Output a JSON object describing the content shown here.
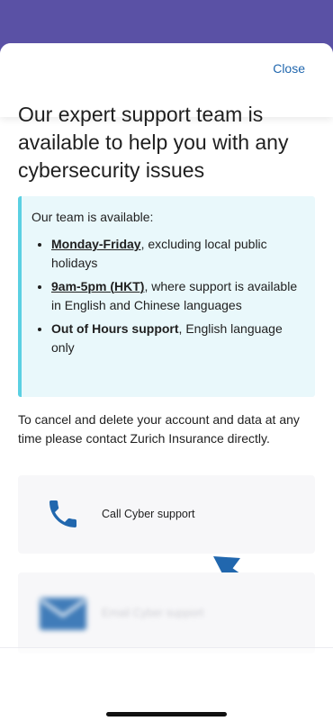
{
  "header": {
    "close_label": "Close"
  },
  "headline": "Our expert support team is available to help you with any cybersecurity issues",
  "availability": {
    "intro": "Our team is available:",
    "items": [
      {
        "bold": "Monday-Friday",
        "rest": ", excluding local public holidays"
      },
      {
        "bold": "9am-5pm (HKT)",
        "rest": ", where support is available in English and Chinese languages"
      },
      {
        "bold": "Out of Hours support",
        "rest": ", English language only"
      }
    ]
  },
  "cancel_text": "To cancel and delete your account and data at any time please contact Zurich Insurance directly.",
  "support_options": {
    "call_label": "Call Cyber support",
    "email_label": "Email Cyber support"
  },
  "colors": {
    "brand_purple": "#5a51a5",
    "link_blue": "#2167ae",
    "info_bg": "#e9f8fb",
    "info_border": "#5bd0e2",
    "card_bg": "#f7f7f9"
  },
  "icons": {
    "call": "phone-icon",
    "email": "envelope-icon",
    "annotation": "arrow-icon"
  }
}
